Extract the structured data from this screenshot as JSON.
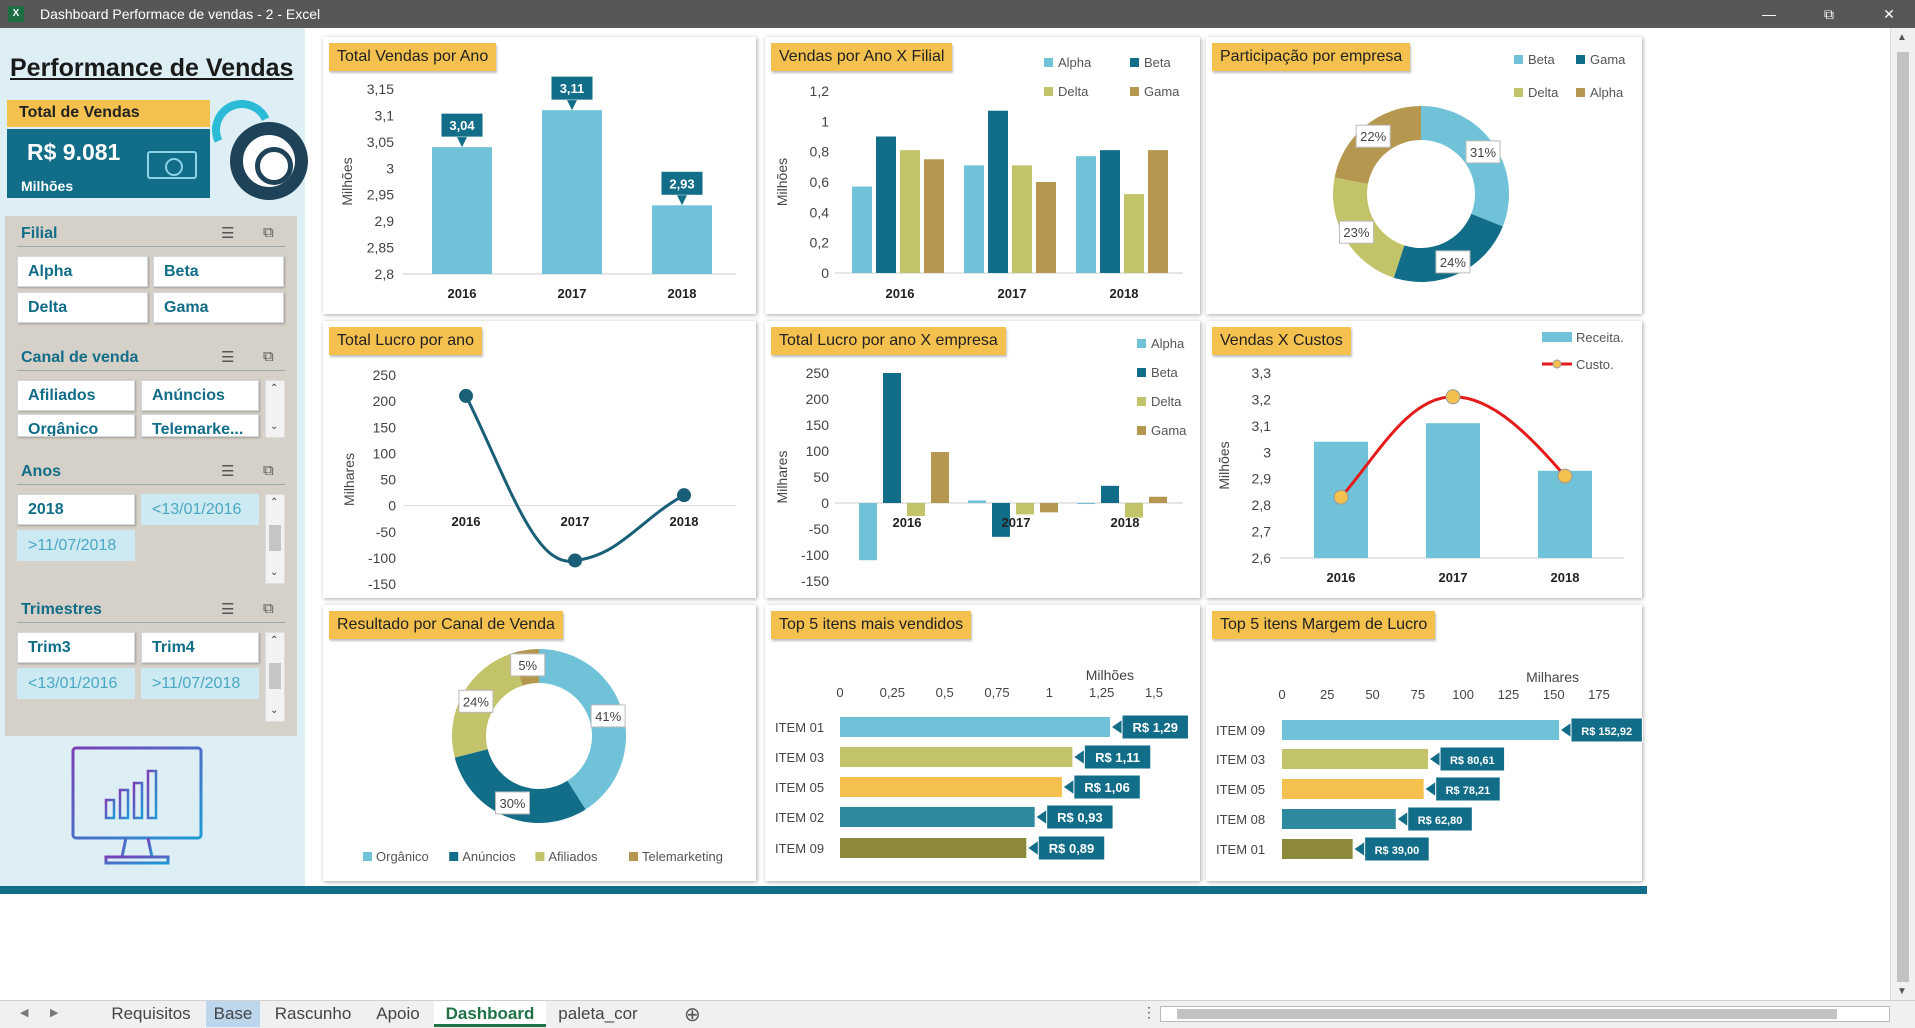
{
  "window": {
    "title": "Dashboard Performace de vendas - 2 - Excel",
    "app_icon": "X"
  },
  "dashboard": {
    "title": "Performance de Vendas",
    "kpi": {
      "label": "Total de Vendas",
      "value": "R$ 9.081",
      "unit": "Milhões"
    }
  },
  "slicers": {
    "filial": {
      "title": "Filial",
      "items": [
        "Alpha",
        "Beta",
        "Delta",
        "Gama"
      ]
    },
    "canal": {
      "title": "Canal de venda",
      "items": [
        "Afiliados",
        "Anúncios",
        "Orgânico",
        "Telemarke..."
      ]
    },
    "anos": {
      "title": "Anos",
      "items": [
        "2018",
        "<13/01/2016",
        ">11/07/2018"
      ]
    },
    "trimestres": {
      "title": "Trimestres",
      "items": [
        "Trim3",
        "Trim4",
        "<13/01/2016",
        ">11/07/2018"
      ]
    }
  },
  "cards": {
    "vendas_ano": {
      "title": "Total Vendas por Ano"
    },
    "vendas_filial": {
      "title": "Vendas por Ano X Filial"
    },
    "participacao": {
      "title": "Participação por empresa"
    },
    "lucro_ano": {
      "title": "Total Lucro por ano"
    },
    "lucro_empresa": {
      "title": "Total Lucro por ano X empresa"
    },
    "vendas_custos": {
      "title": "Vendas X Custos"
    },
    "canal": {
      "title": "Resultado por Canal de Venda"
    },
    "top_vendidos": {
      "title": "Top 5 itens mais vendidos"
    },
    "top_margem": {
      "title": "Top 5 itens Margem de Lucro"
    }
  },
  "chart_data": [
    {
      "id": "vendas_ano",
      "type": "bar",
      "ylabel": "Milhões",
      "categories": [
        "2016",
        "2017",
        "2018"
      ],
      "values": [
        3.04,
        3.11,
        2.93
      ],
      "data_labels": [
        "3,04",
        "3,11",
        "2,93"
      ],
      "ylim": [
        2.8,
        3.15
      ],
      "yticks": [
        "2,8",
        "2,85",
        "2,9",
        "2,95",
        "3",
        "3,05",
        "3,1",
        "3,15"
      ],
      "colors": {
        "bar": "#6fc2d8",
        "label": "#116d88"
      }
    },
    {
      "id": "vendas_filial",
      "type": "bar",
      "ylabel": "Milhões",
      "categories": [
        "2016",
        "2017",
        "2018"
      ],
      "ylim": [
        0,
        1.2
      ],
      "yticks": [
        "0",
        "0,2",
        "0,4",
        "0,6",
        "0,8",
        "1",
        "1,2"
      ],
      "legend": "top-right",
      "series": [
        {
          "name": "Alpha",
          "values": [
            0.57,
            0.71,
            0.77
          ],
          "color": "#6fc2d8"
        },
        {
          "name": "Beta",
          "values": [
            0.9,
            1.07,
            0.81
          ],
          "color": "#116d88"
        },
        {
          "name": "Delta",
          "values": [
            0.81,
            0.71,
            0.52
          ],
          "color": "#c3c36a"
        },
        {
          "name": "Gama",
          "values": [
            0.75,
            0.6,
            0.81
          ],
          "color": "#b5974f"
        }
      ]
    },
    {
      "id": "participacao",
      "type": "pie",
      "legend": "top-right",
      "series": [
        {
          "name": "Beta",
          "value": 31,
          "label": "31%",
          "color": "#6fc2d8"
        },
        {
          "name": "Gama",
          "value": 24,
          "label": "24%",
          "color": "#116d88"
        },
        {
          "name": "Delta",
          "value": 23,
          "label": "23%",
          "color": "#c3c36a"
        },
        {
          "name": "Alpha",
          "value": 22,
          "label": "22%",
          "color": "#b5974f"
        }
      ]
    },
    {
      "id": "lucro_ano",
      "type": "line",
      "ylabel": "Milhares",
      "categories": [
        "2016",
        "2017",
        "2018"
      ],
      "values": [
        210,
        -105,
        20
      ],
      "ylim": [
        -150,
        250
      ],
      "yticks": [
        "250",
        "200",
        "150",
        "100",
        "50",
        "0",
        "-50",
        "-100",
        "-150"
      ],
      "colors": {
        "line": "#1a5f78"
      }
    },
    {
      "id": "lucro_empresa",
      "type": "bar",
      "ylabel": "Milhares",
      "categories": [
        "2016",
        "2017",
        "2018"
      ],
      "ylim": [
        -150,
        250
      ],
      "yticks": [
        "250",
        "200",
        "150",
        "100",
        "50",
        "0",
        "-50",
        "-100",
        "-150"
      ],
      "legend": "top-right",
      "series": [
        {
          "name": "Alpha",
          "values": [
            -110,
            5,
            -2
          ],
          "color": "#6fc2d8"
        },
        {
          "name": "Beta",
          "values": [
            250,
            -65,
            33
          ],
          "color": "#116d88"
        },
        {
          "name": "Delta",
          "values": [
            -25,
            -22,
            -28
          ],
          "color": "#c3c36a"
        },
        {
          "name": "Gama",
          "values": [
            98,
            -18,
            12
          ],
          "color": "#b5974f"
        }
      ]
    },
    {
      "id": "vendas_custos",
      "type": "bar",
      "ylabel": "Milhões",
      "categories": [
        "2016",
        "2017",
        "2018"
      ],
      "ylim": [
        2.6,
        3.3
      ],
      "yticks": [
        "2,6",
        "2,7",
        "2,8",
        "2,9",
        "3",
        "3,1",
        "3,2",
        "3,3"
      ],
      "legend": "top-right",
      "series": [
        {
          "name": "Receita.",
          "type": "bar",
          "values": [
            3.04,
            3.11,
            2.93
          ],
          "color": "#6fc2d8"
        },
        {
          "name": "Custo.",
          "type": "line",
          "values": [
            2.83,
            3.21,
            2.91
          ],
          "color": "#e51a1a"
        }
      ]
    },
    {
      "id": "canal",
      "type": "pie",
      "legend": "bottom",
      "series": [
        {
          "name": "Orgânico",
          "value": 41,
          "label": "41%",
          "color": "#6fc2d8"
        },
        {
          "name": "Anúncios",
          "value": 30,
          "label": "30%",
          "color": "#116d88"
        },
        {
          "name": "Afiliados",
          "value": 24,
          "label": "24%",
          "color": "#c3c36a"
        },
        {
          "name": "Telemarketing",
          "value": 5,
          "label": "5%",
          "color": "#b5974f"
        }
      ]
    },
    {
      "id": "top_vendidos",
      "type": "bar",
      "orientation": "horizontal",
      "unit": "Milhões",
      "xlim": [
        0,
        1.5
      ],
      "xticks": [
        "0",
        "0,25",
        "0,5",
        "0,75",
        "1",
        "1,25",
        "1,5"
      ],
      "categories": [
        "ITEM 01",
        "ITEM 03",
        "ITEM 05",
        "ITEM 02",
        "ITEM 09"
      ],
      "values": [
        1.29,
        1.11,
        1.06,
        0.93,
        0.89
      ],
      "data_labels": [
        "R$ 1,29",
        "R$ 1,11",
        "R$ 1,06",
        "R$ 0,93",
        "R$ 0,89"
      ],
      "colors": [
        "#6fc2d8",
        "#c3c36a",
        "#f4c14f",
        "#2f8aa0",
        "#8c8a3a"
      ]
    },
    {
      "id": "top_margem",
      "type": "bar",
      "orientation": "horizontal",
      "unit": "Milhares",
      "xlim": [
        0,
        175
      ],
      "xticks": [
        "0",
        "25",
        "50",
        "75",
        "100",
        "125",
        "150",
        "175"
      ],
      "categories": [
        "ITEM 09",
        "ITEM 03",
        "ITEM 05",
        "ITEM 08",
        "ITEM 01"
      ],
      "values": [
        152.92,
        80.61,
        78.21,
        62.8,
        39.0
      ],
      "data_labels": [
        "R$ 152,92",
        "R$ 80,61",
        "R$ 78,21",
        "R$ 62,80",
        "R$ 39,00"
      ],
      "colors": [
        "#6fc2d8",
        "#c3c36a",
        "#f4c14f",
        "#2f8aa0",
        "#8c8a3a"
      ]
    }
  ],
  "tabs": [
    {
      "label": "Requisitos"
    },
    {
      "label": "Base"
    },
    {
      "label": "Rascunho"
    },
    {
      "label": "Apoio"
    },
    {
      "label": "Dashboard"
    },
    {
      "label": "paleta_cor"
    }
  ]
}
